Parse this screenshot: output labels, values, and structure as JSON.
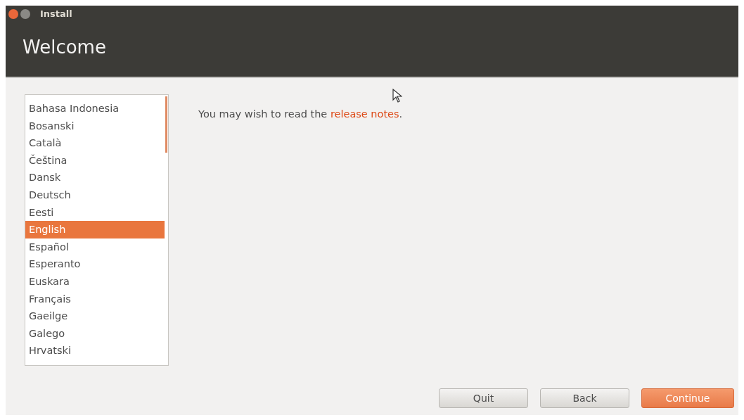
{
  "window": {
    "title": "Install"
  },
  "header": {
    "title": "Welcome"
  },
  "languages": [
    {
      "label": "Bahasa Indonesia",
      "selected": false
    },
    {
      "label": "Bosanski",
      "selected": false
    },
    {
      "label": "Català",
      "selected": false
    },
    {
      "label": "Čeština",
      "selected": false
    },
    {
      "label": "Dansk",
      "selected": false
    },
    {
      "label": "Deutsch",
      "selected": false
    },
    {
      "label": "Eesti",
      "selected": false
    },
    {
      "label": "English",
      "selected": true
    },
    {
      "label": "Español",
      "selected": false
    },
    {
      "label": "Esperanto",
      "selected": false
    },
    {
      "label": "Euskara",
      "selected": false
    },
    {
      "label": "Français",
      "selected": false
    },
    {
      "label": "Gaeilge",
      "selected": false
    },
    {
      "label": "Galego",
      "selected": false
    },
    {
      "label": "Hrvatski",
      "selected": false
    }
  ],
  "message": {
    "before": "You may wish to read the ",
    "link": "release notes",
    "after": "."
  },
  "buttons": [
    {
      "label": "Quit",
      "kind": "normal"
    },
    {
      "label": "Back",
      "kind": "normal"
    },
    {
      "label": "Continue",
      "kind": "primary"
    }
  ]
}
